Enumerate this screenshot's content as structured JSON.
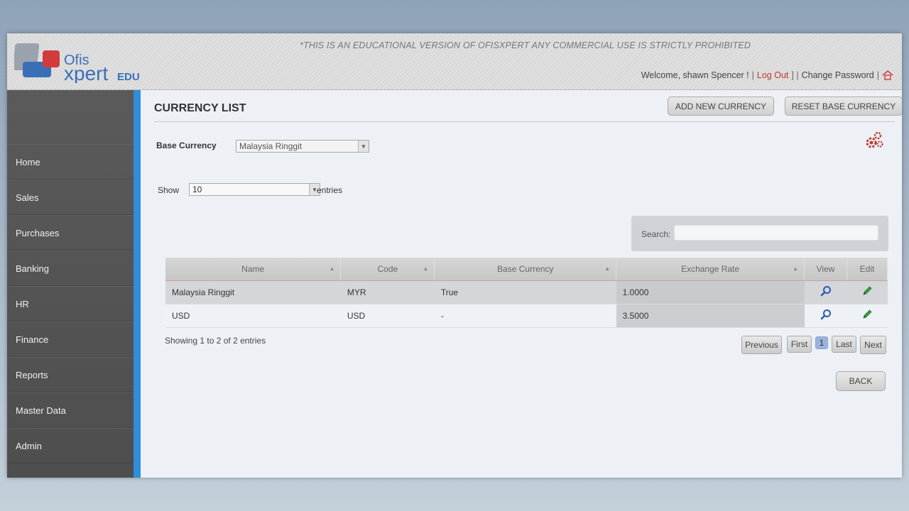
{
  "header": {
    "logo_text_ofis": "Ofis",
    "logo_text_xpert": "xpert",
    "logo_text_edu": "EDU",
    "notice": "*THIS IS AN EDUCATIONAL VERSION OF OFISXPERT ANY COMMERCIAL USE IS STRICTLY PROHIBITED",
    "welcome": "Welcome, shawn Spencer !",
    "pipe1": "|",
    "logout": "Log Out",
    "pipe2": "] |",
    "change_password": "Change Password",
    "pipe3": "|",
    "home_icon": "home-icon"
  },
  "sidebar": {
    "items": [
      {
        "label": "Home"
      },
      {
        "label": "Sales"
      },
      {
        "label": "Purchases"
      },
      {
        "label": "Banking"
      },
      {
        "label": "HR"
      },
      {
        "label": "Finance"
      },
      {
        "label": "Reports"
      },
      {
        "label": "Master Data"
      },
      {
        "label": "Admin"
      }
    ]
  },
  "main": {
    "title": "CURRENCY LIST",
    "add_button": "ADD NEW CURRENCY",
    "reset_button": "RESET BASE CURRENCY",
    "base_currency_label": "Base Currency",
    "base_currency_value": "Malaysia Ringgit",
    "show_label": "Show",
    "show_value": "10",
    "entries_label": "entries",
    "search_label": "Search:",
    "search_value": "",
    "table": {
      "headers": [
        "Name",
        "Code",
        "Base Currency",
        "Exchange Rate",
        "View",
        "Edit"
      ],
      "rows": [
        {
          "name": "Malaysia Ringgit",
          "code": "MYR",
          "base": "True",
          "rate": "1.0000"
        },
        {
          "name": "USD",
          "code": "USD",
          "base": "-",
          "rate": "3.5000"
        }
      ]
    },
    "info": "Showing 1 to 2 of 2 entries",
    "pagination": {
      "previous": "Previous",
      "first": "First",
      "page": "1",
      "last": "Last",
      "next": "Next"
    },
    "back_button": "BACK"
  },
  "colors": {
    "accent_blue": "#2f8ed8",
    "logout_red": "#c0392b",
    "sidebar_bg": "#555555"
  }
}
